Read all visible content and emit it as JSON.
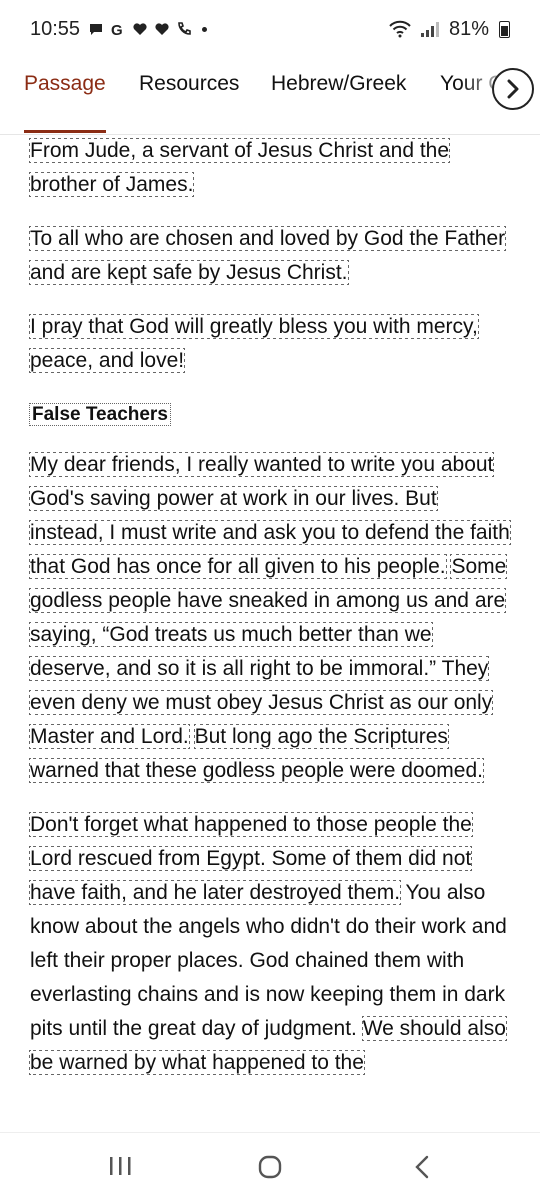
{
  "status_bar": {
    "time": "10:55",
    "battery": "81%"
  },
  "tabs": [
    {
      "label": "Passage",
      "active": true
    },
    {
      "label": "Resources",
      "active": false
    },
    {
      "label": "Hebrew/Greek",
      "active": false
    },
    {
      "label": "Your C",
      "active": false
    }
  ],
  "colors": {
    "accent": "#8b2c14"
  },
  "passage": {
    "p1": "From Jude, a servant of Jesus Christ and the brother of James.",
    "p2": "To all who are chosen and loved by God the Father and are kept safe by Jesus Christ.",
    "p3": "I pray that God will greatly bless you with mercy, peace, and love!",
    "heading": "False Teachers",
    "p4_s1": "My dear friends, I really wanted to write you about God's saving power at work in our lives. But instead, I must write and ask you to defend the faith that God has once for all given to his people.",
    "p4_s2": "Some godless people have sneaked in among us and are saying, “God treats us much better than we deserve, and so it is all right to be immoral.” They even deny we must obey Jesus Christ as our only Master and Lord.",
    "p4_s3": "But long ago the Scriptures warned that these godless people were doomed.",
    "p5_s1": "Don't forget what happened to those people the Lord rescued from Egypt. Some of them did not have faith, and he later destroyed them.",
    "p5_s2": "You also know about the angels who didn't do their work and left their proper places. God chained them with everlasting chains and is now keeping them in dark pits until the great day of judgment.",
    "p5_s3": "We should also be warned by what happened to the"
  },
  "icons": {
    "next": "chevron-right-icon",
    "nav_recent": "recent-apps-icon",
    "nav_home": "home-icon",
    "nav_back": "back-icon"
  }
}
